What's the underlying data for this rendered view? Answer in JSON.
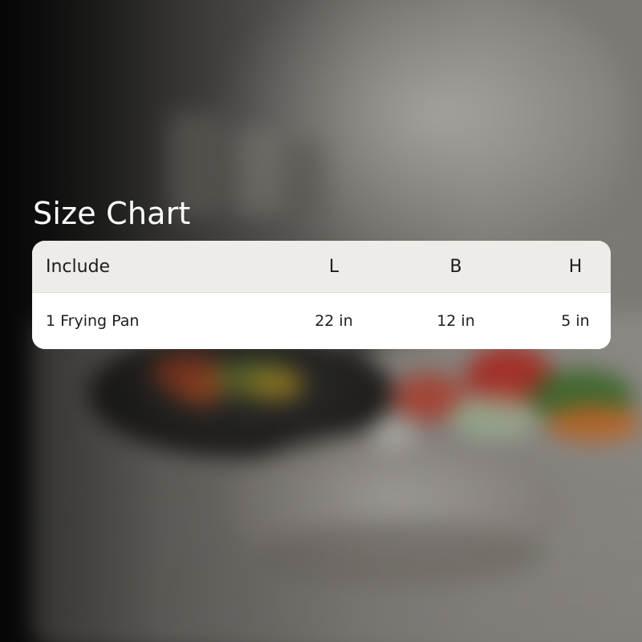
{
  "title": "Size Chart",
  "table": {
    "headers": [
      "Include",
      "L",
      "B",
      "H"
    ],
    "rows": [
      [
        "1 Frying Pan",
        "22 in",
        "12 in",
        "5 in"
      ]
    ]
  },
  "colors": {
    "header_background": "#eeece8",
    "row_background": "#ffffff",
    "title_text": "#ffffff",
    "table_text": "#1d1d1d"
  }
}
